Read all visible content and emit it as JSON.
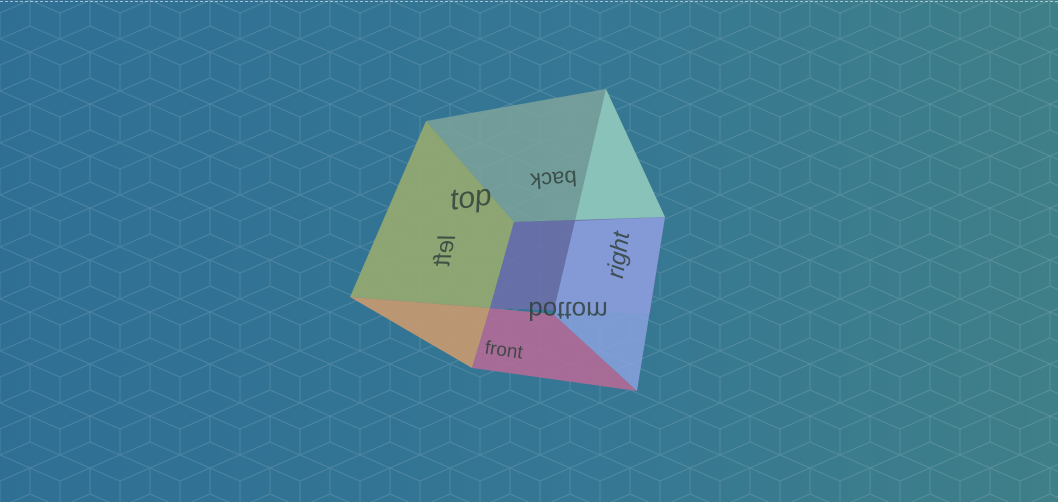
{
  "scene": {
    "background_color": "#357794",
    "pattern": "isometric-cube-grid"
  },
  "cube": {
    "faces": {
      "top": {
        "label": "top",
        "color": "#9aab6e"
      },
      "back": {
        "label": "back",
        "color": "#7ea39b"
      },
      "left": {
        "label": "left",
        "color": "#8fa776"
      },
      "right": {
        "label": "right",
        "color": "#8aa1de"
      },
      "bottom": {
        "label": "bottom",
        "color": "#6b6fa8"
      },
      "front": {
        "label": "front",
        "color": "#b26a97"
      },
      "front_left": {
        "color": "#c99a6e"
      }
    }
  }
}
